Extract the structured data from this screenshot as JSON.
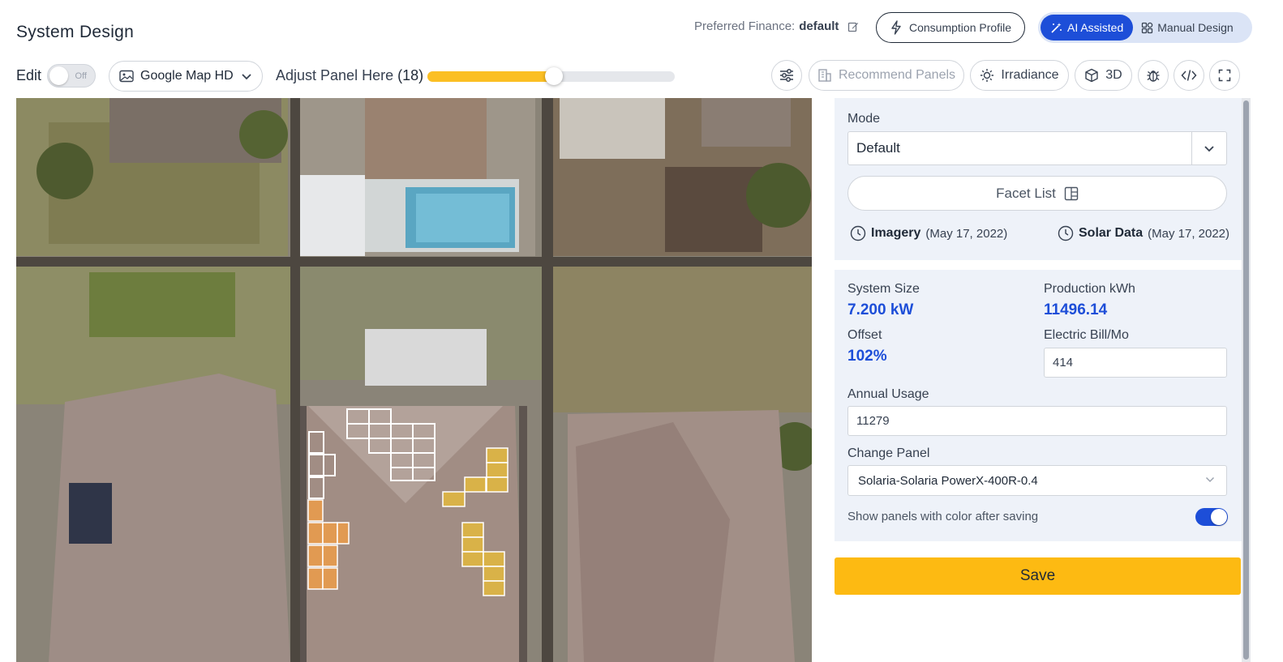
{
  "header": {
    "title": "System Design",
    "preferred_finance_label": "Preferred Finance:",
    "preferred_finance_value": "default",
    "consumption_profile_label": "Consumption Profile",
    "mode_ai_label": "AI Assisted",
    "mode_manual_label": "Manual Design",
    "active_mode": "AI Assisted"
  },
  "toolbar": {
    "edit_label": "Edit",
    "edit_toggle_text": "Off",
    "edit_enabled": false,
    "map_source": "Google Map HD",
    "adjust_label": "Adjust Panel Here",
    "adjust_count": "(18)",
    "adjust_fraction": 0.51,
    "recommend_panels_label": "Recommend Panels",
    "irradiance_label": "Irradiance",
    "three_d_label": "3D"
  },
  "icons": [
    "edit-icon",
    "lightning-icon",
    "wand-icon",
    "grid-icon",
    "image-icon",
    "chevron-down-icon",
    "sliders-icon",
    "building-icon",
    "sun-icon",
    "cube-icon",
    "bug-icon",
    "code-icon",
    "fullscreen-icon",
    "panel-icon",
    "clock-icon"
  ],
  "colors": {
    "accent": "#1d4ed8",
    "save": "#fdba12",
    "slider_fill": "#fbbf24",
    "panel_orange": "#e19a52",
    "panel_yellow": "#d9b248"
  },
  "panel": {
    "mode_label": "Mode",
    "mode_value": "Default",
    "facet_list_label": "Facet List",
    "imagery_label": "Imagery",
    "imagery_date": "(May 17, 2022)",
    "solar_data_label": "Solar Data",
    "solar_data_date": "(May 17, 2022)",
    "system_size_label": "System Size",
    "system_size_value": "7.200 kW",
    "production_label": "Production kWh",
    "production_value": "11496.14",
    "offset_label": "Offset",
    "offset_value": "102%",
    "electric_bill_label": "Electric Bill/Mo",
    "electric_bill_value": "414",
    "annual_usage_label": "Annual Usage",
    "annual_usage_value": "11279",
    "change_panel_label": "Change Panel",
    "change_panel_value": "Solaria-Solaria PowerX-400R-0.4",
    "show_colors_label": "Show panels with color after saving",
    "show_colors_enabled": true,
    "save_label": "Save"
  }
}
